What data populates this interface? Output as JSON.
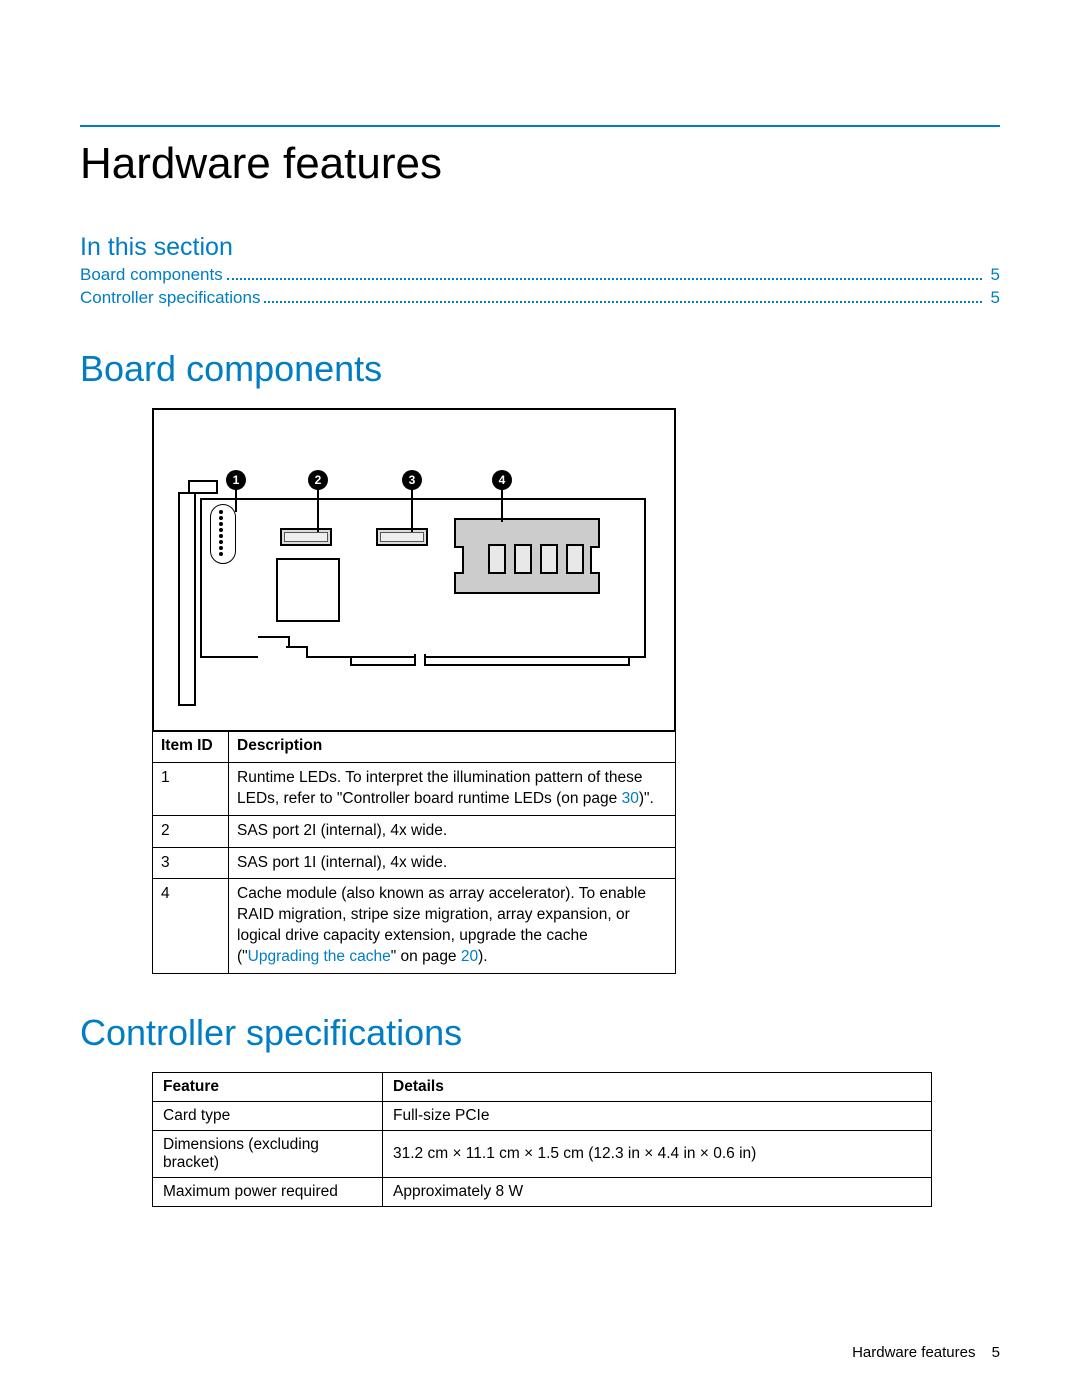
{
  "page": {
    "title": "Hardware features",
    "in_this_section": "In this section",
    "footer_label": "Hardware features",
    "footer_page": "5"
  },
  "toc": [
    {
      "label": "Board components",
      "page": "5"
    },
    {
      "label": "Controller specifications",
      "page": "5"
    }
  ],
  "sections": {
    "board": "Board components",
    "specs": "Controller specifications"
  },
  "callouts": {
    "c1": "1",
    "c2": "2",
    "c3": "3",
    "c4": "4"
  },
  "board_table": {
    "headers": {
      "id": "Item ID",
      "desc": "Description"
    },
    "rows": [
      {
        "id": "1",
        "desc_a": "Runtime LEDs. To interpret the illumination pattern of these LEDs, refer to \"Controller board runtime LEDs (on page ",
        "link": "30",
        "desc_b": ")\"."
      },
      {
        "id": "2",
        "desc": "SAS port 2I (internal), 4x wide."
      },
      {
        "id": "3",
        "desc": "SAS port 1I (internal), 4x wide."
      },
      {
        "id": "4",
        "desc_a": "Cache module (also known as array accelerator). To enable RAID migration, stripe size migration, array expansion, or logical drive capacity extension, upgrade the cache (\"",
        "link1": "Upgrading the cache",
        "desc_b": "\" on page ",
        "link2": "20",
        "desc_c": ")."
      }
    ]
  },
  "spec_table": {
    "headers": {
      "feature": "Feature",
      "details": "Details"
    },
    "rows": [
      {
        "feature": "Card type",
        "details": "Full-size PCIe"
      },
      {
        "feature": "Dimensions (excluding bracket)",
        "details": "31.2 cm × 11.1 cm × 1.5 cm (12.3 in × 4.4 in × 0.6 in)"
      },
      {
        "feature": "Maximum power required",
        "details": "Approximately 8 W"
      }
    ]
  }
}
